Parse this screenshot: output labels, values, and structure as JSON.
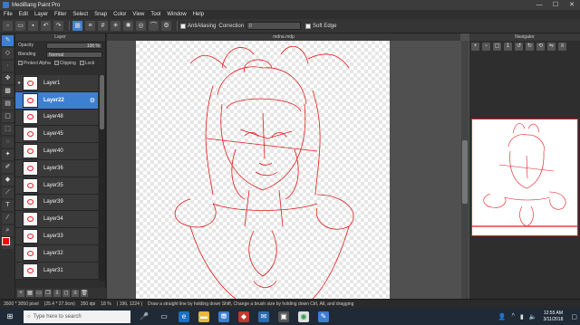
{
  "app": {
    "title": "MediBang Paint Pro",
    "window_controls": [
      "—",
      "☐",
      "✕"
    ]
  },
  "menu": [
    "File",
    "Edit",
    "Layer",
    "Filter",
    "Select",
    "Snap",
    "Color",
    "View",
    "Tool",
    "Window",
    "Help"
  ],
  "toolbar": {
    "antialiasing_label": "AntiAliasing",
    "correction_label": "Correction",
    "correction_value": "0",
    "softedge_label": "Soft Edge"
  },
  "layer_panel": {
    "title": "Layer",
    "opacity_label": "Opacity",
    "opacity_value": "100 %",
    "blending_label": "Blending",
    "blending_value": "Normal",
    "protect_alpha": "Protect Alpha",
    "clipping": "Clipping",
    "lock": "Lock",
    "layers": [
      {
        "name": "Layer1",
        "selected": false
      },
      {
        "name": "Layer22",
        "selected": true
      },
      {
        "name": "Layer48",
        "selected": false
      },
      {
        "name": "Layer45",
        "selected": false
      },
      {
        "name": "Layer40",
        "selected": false
      },
      {
        "name": "Layer36",
        "selected": false
      },
      {
        "name": "Layer35",
        "selected": false
      },
      {
        "name": "Layer39",
        "selected": false
      },
      {
        "name": "Layer34",
        "selected": false
      },
      {
        "name": "Layer33",
        "selected": false
      },
      {
        "name": "Layer32",
        "selected": false
      },
      {
        "name": "Layer31",
        "selected": false
      }
    ]
  },
  "document": {
    "tab_title": "mdna.mdp"
  },
  "navigator": {
    "title": "Navigator"
  },
  "status": {
    "size": "3500 * 3050 pixel",
    "physical": "(25.4 * 27.9cm)",
    "dpi": "350 dpi",
    "zoom": "18 %",
    "coords": "( 196, 1224 )",
    "hint": "Draw a straight line by holding down Shift, Change a brush size by holding down Ctrl, Alt, and dragging"
  },
  "taskbar": {
    "search_placeholder": "Type here to search",
    "time": "12:55 AM",
    "date": "3/11/2018"
  },
  "colors": {
    "accent": "#3d7fd1",
    "brush": "#ff0000"
  }
}
